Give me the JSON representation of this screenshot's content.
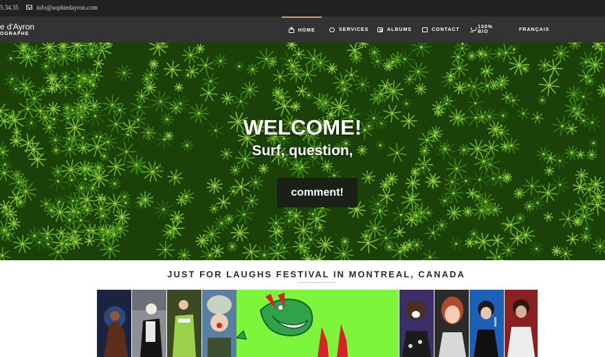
{
  "topbar": {
    "phone": "5.34.35",
    "email": "info@sophiedayron.com"
  },
  "brand": {
    "name": "e d'Ayron",
    "subtitle": "OGRAPHE"
  },
  "nav": {
    "items": [
      {
        "label": "HOME",
        "icon": "home-icon",
        "active": true
      },
      {
        "label": "SERVICES",
        "icon": "crosshair-icon",
        "active": false
      },
      {
        "label": "ALBUMS",
        "icon": "camera-icon",
        "active": false
      },
      {
        "label": "CONTACT",
        "icon": "envelope-icon",
        "active": false
      },
      {
        "label": "100% BIO",
        "icon": "bio-icon",
        "active": false
      },
      {
        "label": "FRANÇAIS",
        "icon": "",
        "active": false
      }
    ]
  },
  "hero": {
    "title": "WELCOME!",
    "subtitle": "Surf, question,",
    "cta": "comment!"
  },
  "section": {
    "title": "JUST FOR LAUGHS FESTIVAL IN MONTREAL, CANADA"
  },
  "gallery": {
    "photos": [
      {
        "name": "photo-masked-performer"
      },
      {
        "name": "photo-mime-artist"
      },
      {
        "name": "photo-green-costume"
      },
      {
        "name": "photo-clown"
      },
      {
        "name": "photo-festival-logo"
      },
      {
        "name": "photo-comedian-laughing"
      },
      {
        "name": "photo-comedian-woman"
      },
      {
        "name": "photo-comedian-microphone"
      },
      {
        "name": "photo-comedian-man"
      }
    ]
  },
  "colors": {
    "topbar_bg": "#222222",
    "navbar_bg": "#333333",
    "accent": "#c9a16a",
    "hero_green": "#3f8a1a",
    "logo_green": "#7df53a"
  }
}
